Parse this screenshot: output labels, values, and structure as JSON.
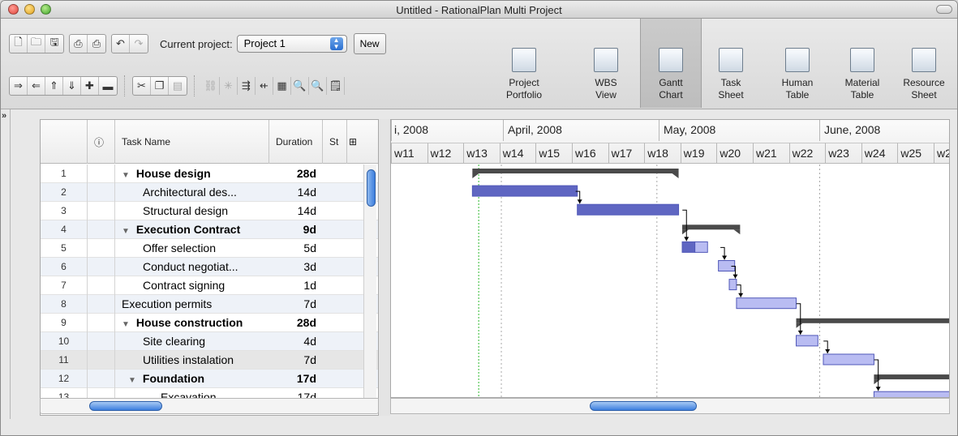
{
  "window": {
    "title": "Untitled - RationalPlan Multi Project"
  },
  "toolbar": {
    "current_project_label": "Current project:",
    "current_project_value": "Project 1",
    "new_button": "New",
    "views": [
      {
        "label": "Project\nPortfolio",
        "icon": "portfolio-icon",
        "active": false
      },
      {
        "label": "WBS\nView",
        "icon": "wbs-icon",
        "active": false
      },
      {
        "label": "Gantt\nChart",
        "icon": "gantt-icon",
        "active": true
      },
      {
        "label": "Task\nSheet",
        "icon": "task-sheet-icon",
        "active": false
      },
      {
        "label": "Human\nTable",
        "icon": "human-table-icon",
        "active": false
      },
      {
        "label": "Material\nTable",
        "icon": "material-table-icon",
        "active": false
      },
      {
        "label": "Resource\nSheet",
        "icon": "resource-sheet-icon",
        "active": false
      }
    ]
  },
  "table": {
    "info_header": "ⓘ",
    "columns": [
      "Task Name",
      "Duration",
      "St"
    ],
    "rows": [
      {
        "num": "1",
        "name": "House design",
        "duration": "28d",
        "level": 0,
        "summary": true
      },
      {
        "num": "2",
        "name": "Architectural des...",
        "duration": "14d",
        "level": 2,
        "summary": false
      },
      {
        "num": "3",
        "name": "Structural design",
        "duration": "14d",
        "level": 2,
        "summary": false
      },
      {
        "num": "4",
        "name": "Execution Contract",
        "duration": "9d",
        "level": 0,
        "summary": true
      },
      {
        "num": "5",
        "name": "Offer selection",
        "duration": "5d",
        "level": 2,
        "summary": false
      },
      {
        "num": "6",
        "name": "Conduct negotiat...",
        "duration": "3d",
        "level": 2,
        "summary": false
      },
      {
        "num": "7",
        "name": "Contract signing",
        "duration": "1d",
        "level": 2,
        "summary": false
      },
      {
        "num": "8",
        "name": "Execution permits",
        "duration": "7d",
        "level": 1,
        "summary": false
      },
      {
        "num": "9",
        "name": "House construction",
        "duration": "28d",
        "level": 0,
        "summary": true
      },
      {
        "num": "10",
        "name": "Site clearing",
        "duration": "4d",
        "level": 2,
        "summary": false
      },
      {
        "num": "11",
        "name": "Utilities instalation",
        "duration": "7d",
        "level": 2,
        "summary": false
      },
      {
        "num": "12",
        "name": "Foundation",
        "duration": "17d",
        "level": 1,
        "summary": true
      },
      {
        "num": "13",
        "name": "Excavation",
        "duration": "17d",
        "level": 3,
        "summary": false
      }
    ]
  },
  "gantt": {
    "months": [
      "i, 2008",
      "April, 2008",
      "May, 2008",
      "June, 2008"
    ],
    "weeks": [
      "w11",
      "w12",
      "w13",
      "w14",
      "w15",
      "w16",
      "w17",
      "w18",
      "w19",
      "w20",
      "w21",
      "w22",
      "w23",
      "w24",
      "w25",
      "w2"
    ],
    "today_week": 2.2,
    "bars": [
      {
        "row": 0,
        "start": 2.25,
        "end": 7.95,
        "type": "summary"
      },
      {
        "row": 1,
        "start": 2.25,
        "end": 5.15,
        "type": "task"
      },
      {
        "row": 2,
        "start": 5.15,
        "end": 7.95,
        "type": "task"
      },
      {
        "row": 3,
        "start": 8.05,
        "end": 9.65,
        "type": "summary"
      },
      {
        "row": 4,
        "start": 8.05,
        "end": 8.4,
        "type": "task-partial"
      },
      {
        "row": 4,
        "start": 8.4,
        "end": 8.75,
        "type": "task-light"
      },
      {
        "row": 5,
        "start": 9.05,
        "end": 9.5,
        "type": "task-light"
      },
      {
        "row": 6,
        "start": 9.35,
        "end": 9.55,
        "type": "task-light"
      },
      {
        "row": 7,
        "start": 9.55,
        "end": 11.2,
        "type": "task-light"
      },
      {
        "row": 8,
        "start": 11.2,
        "end": 16.0,
        "type": "summary"
      },
      {
        "row": 9,
        "start": 11.2,
        "end": 11.8,
        "type": "task-light"
      },
      {
        "row": 10,
        "start": 11.95,
        "end": 13.35,
        "type": "task-light"
      },
      {
        "row": 11,
        "start": 13.35,
        "end": 16.0,
        "type": "summary"
      },
      {
        "row": 12,
        "start": 13.35,
        "end": 16.0,
        "type": "task-light"
      }
    ],
    "links": [
      {
        "from_row": 1,
        "to_row": 2,
        "week": 5.15
      },
      {
        "from_row": 2,
        "to_row": 4,
        "week": 8.1
      },
      {
        "from_row": 4,
        "to_row": 5,
        "week": 9.15
      },
      {
        "from_row": 5,
        "to_row": 6,
        "week": 9.45
      },
      {
        "from_row": 6,
        "to_row": 7,
        "week": 9.6
      },
      {
        "from_row": 7,
        "to_row": 9,
        "week": 11.25
      },
      {
        "from_row": 9,
        "to_row": 10,
        "week": 12.0
      },
      {
        "from_row": 10,
        "to_row": 12,
        "week": 13.4
      }
    ]
  },
  "colors": {
    "task_dark": "#5f66c2",
    "task_light": "#b9bcf2",
    "task_border": "#5058b8",
    "summary": "#4a4a4a",
    "today_line": "#2db82d",
    "today_marker": "#2a5fe0"
  }
}
